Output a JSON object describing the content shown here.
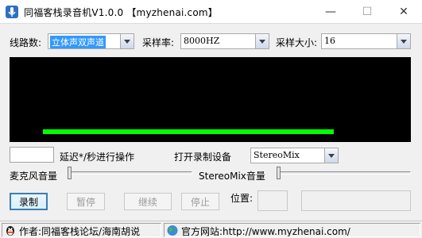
{
  "window": {
    "title": "同福客栈录音机V1.0.0 【myzhenai.com】",
    "min_glyph": "—",
    "max_glyph": "☐",
    "close_glyph": "✕"
  },
  "settings": {
    "line_label": "线路数:",
    "line_value": "立体声双声道",
    "samplerate_label": "采样率:",
    "samplerate_value": "8000HZ",
    "samplesize_label": "采样大小:",
    "samplesize_value": "16"
  },
  "visualizer": {
    "level": 0.87,
    "bar_color": "#00ff00",
    "background": "#000000"
  },
  "delay": {
    "value": "",
    "label": "延迟*/秒进行操作"
  },
  "device": {
    "label": "打开录制设备",
    "value": "StereoMix"
  },
  "volumes": {
    "mic_label": "麦克风音量",
    "mic_level": 0.0,
    "stereomix_label": "StereoMix音量",
    "stereomix_level": 0.0
  },
  "buttons": {
    "record": "录制",
    "pause": "暂停",
    "resume": "继续",
    "stop": "停止"
  },
  "position": {
    "label": "位置:",
    "value": "",
    "value2": ""
  },
  "statusbar": {
    "author": "作者:同福客栈论坛/海南胡说",
    "website": "官方网站:http://www.myzhenai.com/"
  }
}
